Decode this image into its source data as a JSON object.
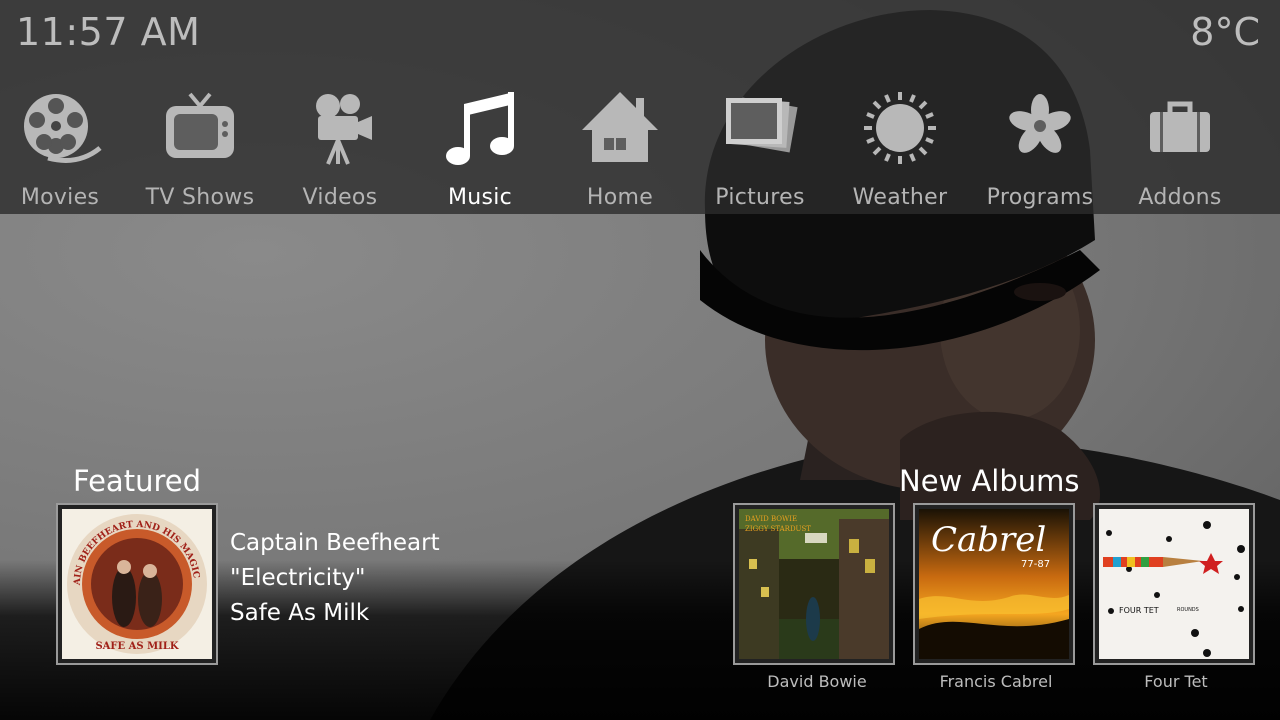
{
  "status": {
    "time": "11:57 AM",
    "temperature": "8°C"
  },
  "menu": [
    {
      "label": "Movies",
      "icon": "film-reel-icon"
    },
    {
      "label": "TV Shows",
      "icon": "tv-icon"
    },
    {
      "label": "Videos",
      "icon": "video-camera-icon"
    },
    {
      "label": "Music",
      "icon": "music-note-icon",
      "active": true
    },
    {
      "label": "Home",
      "icon": "house-icon"
    },
    {
      "label": "Pictures",
      "icon": "photos-icon"
    },
    {
      "label": "Weather",
      "icon": "sun-icon"
    },
    {
      "label": "Programs",
      "icon": "flower-icon"
    },
    {
      "label": "Addons",
      "icon": "briefcase-icon"
    }
  ],
  "featured": {
    "title": "Featured",
    "artist": "Captain Beefheart",
    "track": "\"Electricity\"",
    "album": "Safe As Milk",
    "cover_text": [
      "CAPTAIN BEEFHEART AND HIS MAGIC BAND",
      "SAFE AS MILK"
    ]
  },
  "new_albums": {
    "title": "New Albums",
    "items": [
      {
        "artist": "David Bowie",
        "cover_text": [
          "DAVID BOWIE",
          "ZIGGY STARDUST"
        ]
      },
      {
        "artist": "Francis Cabrel",
        "cover_text": [
          "Cabrel",
          "77-87"
        ]
      },
      {
        "artist": "Four Tet",
        "cover_text": [
          "FOUR TET",
          "ROUNDS"
        ]
      }
    ]
  },
  "colors": {
    "active_label": "#ffffff",
    "inactive_label": "#b4b4b4",
    "top_bar": "#2c2c2c"
  }
}
